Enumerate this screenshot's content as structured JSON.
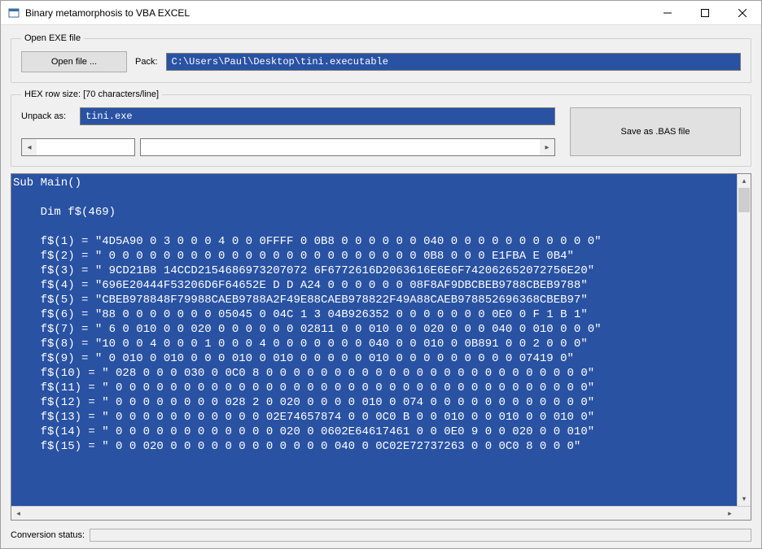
{
  "window": {
    "title": "Binary metamorphosis to VBA EXCEL"
  },
  "open_group": {
    "legend": "Open EXE file",
    "open_button": "Open file ...",
    "pack_label": "Pack:",
    "pack_value": "C:\\Users\\Paul\\Desktop\\tini.executable"
  },
  "hex_group": {
    "legend": "HEX row size: [70 characters/line]",
    "unpack_label": "Unpack as:",
    "unpack_value": "tini.exe",
    "save_button": "Save as .BAS file"
  },
  "code_lines": [
    "Sub Main()",
    "",
    "    Dim f$(469)",
    "",
    "    f$(1) = \"4D5A90 0 3 0 0 0 4 0 0 0FFFF 0 0B8 0 0 0 0 0 0 040 0 0 0 0 0 0 0 0 0 0 0\"",
    "    f$(2) = \" 0 0 0 0 0 0 0 0 0 0 0 0 0 0 0 0 0 0 0 0 0 0 0 0B8 0 0 0 E1FBA E 0B4\"",
    "    f$(3) = \" 9CD21B8 14CCD2154686973207072 6F6772616D2063616E6E6F742062652072756E20\"",
    "    f$(4) = \"696E20444F53206D6F64652E D D A24 0 0 0 0 0 0 08F8AF9DBCBEB9788CBEB9788\"",
    "    f$(5) = \"CBEB978848F79988CAEB9788A2F49E88CAEB978822F49A88CAEB978852696368CBEB97\"",
    "    f$(6) = \"88 0 0 0 0 0 0 0 05045 0 04C 1 3 04B926352 0 0 0 0 0 0 0 0E0 0 F 1 B 1\"",
    "    f$(7) = \" 6 0 010 0 0 020 0 0 0 0 0 0 02811 0 0 010 0 0 020 0 0 0 040 0 010 0 0 0\"",
    "    f$(8) = \"10 0 0 4 0 0 0 1 0 0 0 4 0 0 0 0 0 0 0 040 0 0 010 0 0B891 0 0 2 0 0 0\"",
    "    f$(9) = \" 0 010 0 010 0 0 0 010 0 010 0 0 0 0 0 010 0 0 0 0 0 0 0 0 0 07419 0\"",
    "    f$(10) = \" 028 0 0 0 030 0 0C0 8 0 0 0 0 0 0 0 0 0 0 0 0 0 0 0 0 0 0 0 0 0 0 0 0\"",
    "    f$(11) = \" 0 0 0 0 0 0 0 0 0 0 0 0 0 0 0 0 0 0 0 0 0 0 0 0 0 0 0 0 0 0 0 0 0 0 0\"",
    "    f$(12) = \" 0 0 0 0 0 0 0 0 028 2 0 020 0 0 0 0 010 0 074 0 0 0 0 0 0 0 0 0 0 0 0\"",
    "    f$(13) = \" 0 0 0 0 0 0 0 0 0 0 0 02E74657874 0 0 0C0 B 0 0 010 0 0 010 0 0 010 0\"",
    "    f$(14) = \" 0 0 0 0 0 0 0 0 0 0 0 0 020 0 0602E64617461 0 0 0E0 9 0 0 020 0 0 010\"",
    "    f$(15) = \" 0 0 020 0 0 0 0 0 0 0 0 0 0 0 0 040 0 0C02E72737263 0 0 0C0 8 0 0 0\""
  ],
  "status": {
    "label": "Conversion status:"
  }
}
